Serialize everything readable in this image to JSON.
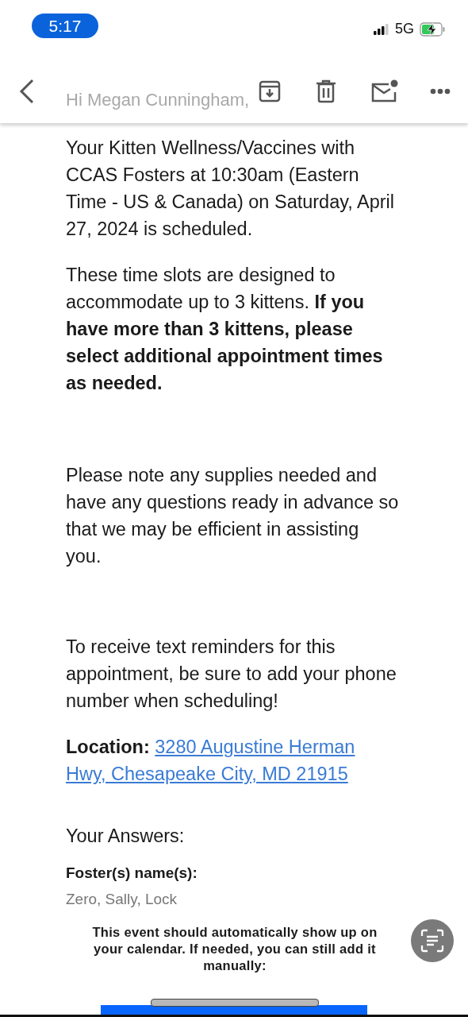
{
  "status_bar": {
    "time": "5:17",
    "network": "5G"
  },
  "toolbar": {
    "greeting": "Hi Megan Cunningham,"
  },
  "paragraphs": [
    "Your Kitten Wellness/Vaccines with CCAS Fosters at 10:30am (Eastern Time - US & Canada) on Saturday, April 27, 2024 is scheduled.",
    "These time slots are designed to accommodate up to 3 kittens. **If you have more than 3 kittens, please select additional appointment times as needed.**",
    "Please note any supplies needed and have any questions ready in advance so that we may be efficient in assisting you.",
    "To receive text reminders for this appointment, be sure to add your phone number when scheduling!"
  ],
  "location": {
    "label": "Location:",
    "address": "3280 Augustine Herman Hwy, Chesapeake City, MD 21915"
  },
  "answers": {
    "heading": "Your Answers:",
    "fields": [
      {
        "label": "Foster(s) name(s):",
        "value": "Zero, Sally, Lock"
      }
    ]
  },
  "calendar_note": "This event should automatically show up on your calendar. If needed, you can still add it manually:"
}
